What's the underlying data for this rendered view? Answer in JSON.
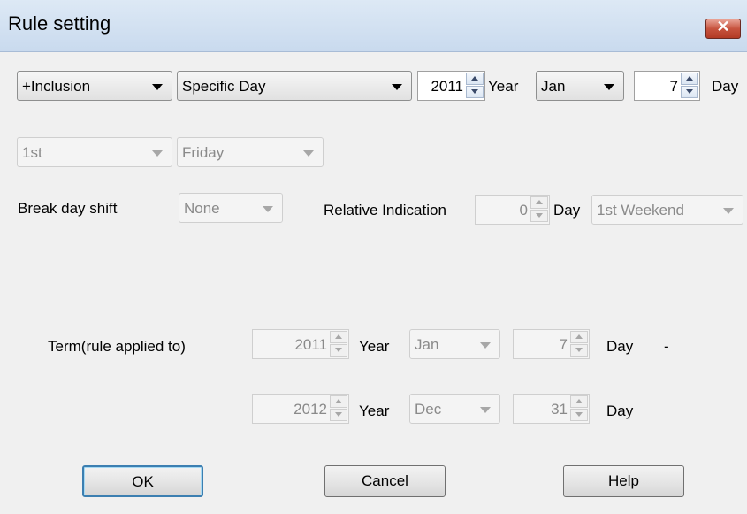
{
  "window": {
    "title": "Rule setting",
    "close_symbol": "✕"
  },
  "row1": {
    "type": "+Inclusion",
    "mode": "Specific Day",
    "year_value": "2011",
    "year_label": "Year",
    "month": "Jan",
    "day_value": "7",
    "day_label": "Day"
  },
  "row2": {
    "ordinal": "1st",
    "weekday": "Friday"
  },
  "row3": {
    "break_label": "Break day shift",
    "break_value": "None",
    "relative_label": "Relative Indication",
    "relative_value": "0",
    "relative_day_label": "Day",
    "relative_select": "1st Weekend"
  },
  "term": {
    "label": "Term(rule applied to)",
    "start": {
      "year": "2011",
      "year_label": "Year",
      "month": "Jan",
      "day": "7",
      "day_label": "Day",
      "dash": "-"
    },
    "end": {
      "year": "2012",
      "year_label": "Year",
      "month": "Dec",
      "day": "31",
      "day_label": "Day"
    }
  },
  "buttons": {
    "ok": "OK",
    "cancel": "Cancel",
    "help": "Help"
  }
}
